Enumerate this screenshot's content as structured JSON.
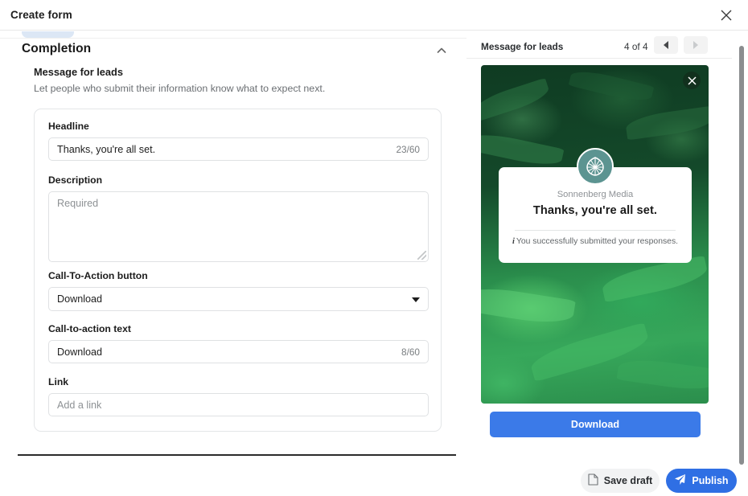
{
  "modal": {
    "title": "Create form",
    "close_icon": "close-icon"
  },
  "section": {
    "title": "Completion",
    "collapse_icon": "chevron-up-icon",
    "sub_title": "Message for leads",
    "sub_desc": "Let people who submit their information know what to expect next."
  },
  "fields": {
    "headline": {
      "label": "Headline",
      "value": "Thanks, you're all set.",
      "counter": "23/60"
    },
    "description": {
      "label": "Description",
      "placeholder": "Required",
      "value": ""
    },
    "cta_button": {
      "label": "Call-To-Action button",
      "value": "Download",
      "caret_icon": "chevron-down-icon"
    },
    "cta_text": {
      "label": "Call-to-action text",
      "value": "Download",
      "counter": "8/60"
    },
    "link": {
      "label": "Link",
      "placeholder": "Add a link",
      "value": ""
    }
  },
  "preview": {
    "header_title": "Message for leads",
    "counter": "4 of 4",
    "prev_icon": "triangle-left-icon",
    "next_icon": "triangle-right-icon",
    "image_close_icon": "close-circle-icon",
    "logo_icon": "leaf-logo-icon",
    "brand_name": "Sonnenberg Media",
    "thanks_title": "Thanks, you're all set.",
    "info_icon": "info-icon",
    "thanks_note": "You successfully submitted your responses.",
    "download_label": "Download"
  },
  "footer": {
    "save_draft_label": "Save draft",
    "save_draft_icon": "document-icon",
    "publish_label": "Publish",
    "publish_icon": "paper-plane-icon"
  },
  "colors": {
    "accent_blue": "#2f6fe4",
    "preview_button_blue": "#3b7ae8",
    "brand_teal": "#5c9491",
    "chip_blue": "#dce7f5"
  }
}
